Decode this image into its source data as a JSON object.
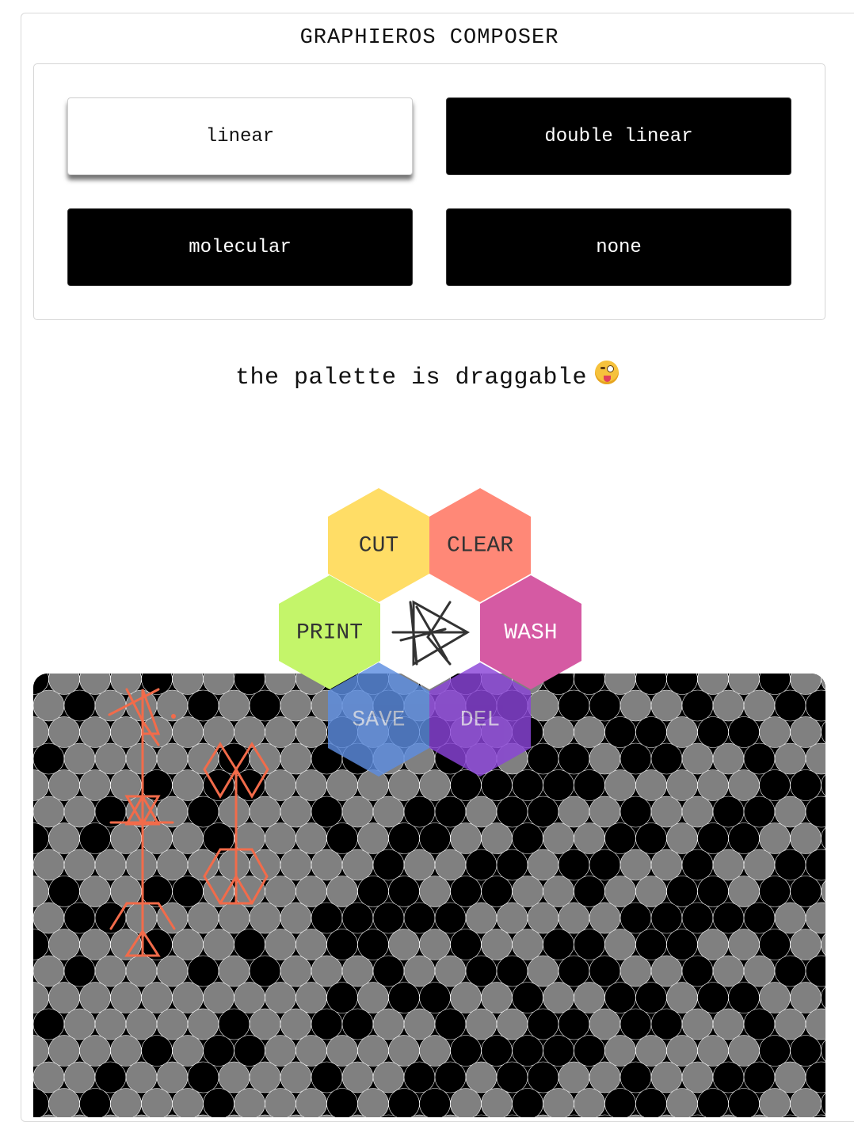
{
  "app": {
    "title": "GRAPHIEROS COMPOSER"
  },
  "modes": {
    "items": [
      {
        "label": "linear",
        "active": true
      },
      {
        "label": "double linear",
        "active": false
      },
      {
        "label": "molecular",
        "active": false
      },
      {
        "label": "none",
        "active": false
      }
    ]
  },
  "hint": {
    "text": "the palette is draggable",
    "emoji": "winking-face-with-tongue"
  },
  "palette": {
    "cut": {
      "label": "CUT",
      "color": "#ffdd66"
    },
    "clear": {
      "label": "CLEAR",
      "color": "#ff8877"
    },
    "print": {
      "label": "PRINT",
      "color": "#c4f56a"
    },
    "wash": {
      "label": "WASH",
      "color": "#d55aa3"
    },
    "save": {
      "label": "SAVE",
      "color": "#5d8de0"
    },
    "del": {
      "label": "DEL",
      "color": "#8a44d8"
    },
    "center_icon": "graphieros-logo-icon"
  },
  "canvas": {
    "cell_on_color": "#000000",
    "cell_off_color": "#808080",
    "stroke_color": "#f26b4a"
  }
}
